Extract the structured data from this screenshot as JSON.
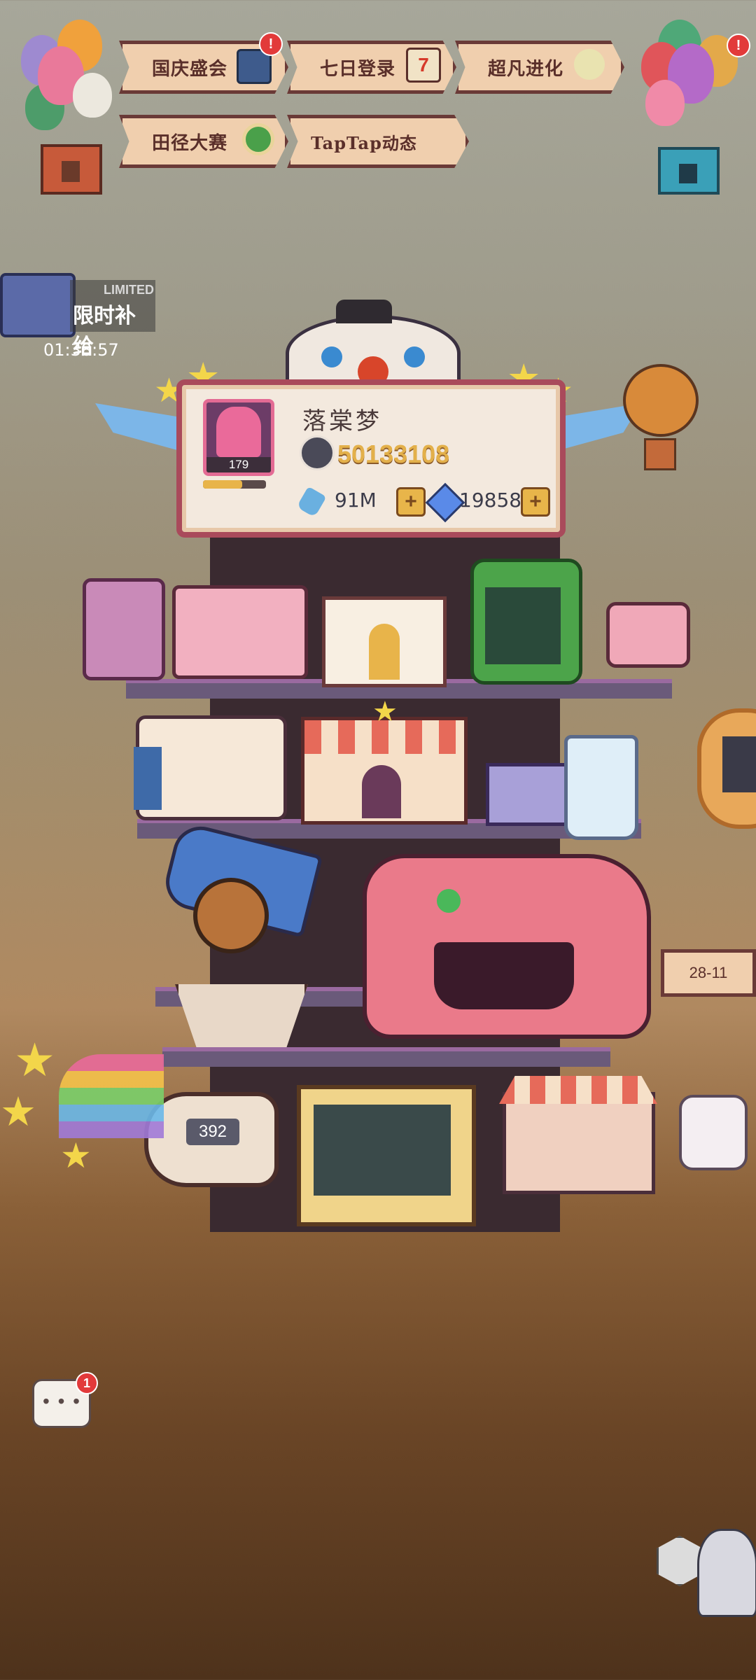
{
  "banners": [
    {
      "label": "国庆盛会",
      "has_badge": true
    },
    {
      "label": "七日登录",
      "icon_text": "7"
    },
    {
      "label": "超凡进化"
    },
    {
      "label": "田径大赛"
    },
    {
      "label": "TapTap动态"
    }
  ],
  "badge_mark": "!",
  "limited": {
    "tag": "LIMITED",
    "title": "限时补给",
    "timer": "01:38:57"
  },
  "profile": {
    "name": "落棠梦",
    "level": "179",
    "score": "50133108",
    "bottles": "91M",
    "gems": "19858",
    "plus": "+"
  },
  "cannon_counter": "392",
  "side_sign": "28-11",
  "chat": {
    "badge": "1"
  },
  "colors": {
    "accent": "#a94a5b",
    "banner_fill": "#f0cfae",
    "score": "#e3b04a"
  }
}
